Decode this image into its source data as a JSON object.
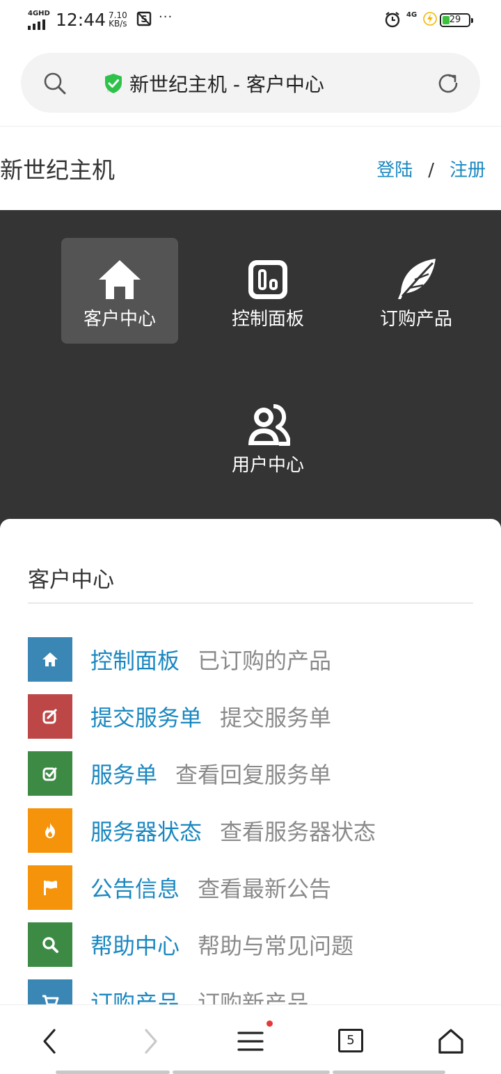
{
  "status": {
    "network": "4GHD",
    "time": "12:44",
    "speed_value": "7.10",
    "speed_unit": "KB/s",
    "network2": "4G",
    "battery": "29",
    "battery_level": 0.29,
    "dots": "···"
  },
  "address_bar": {
    "title": "新世纪主机 - 客户中心"
  },
  "header": {
    "brand": "新世纪主机",
    "login": "登陆",
    "separator": "/",
    "register": "注册"
  },
  "nav": {
    "items": [
      {
        "label": "客户中心",
        "icon": "home-icon",
        "active": true
      },
      {
        "label": "控制面板",
        "icon": "dashboard-icon",
        "active": false
      },
      {
        "label": "订购产品",
        "icon": "feather-icon",
        "active": false
      },
      {
        "label": "用户中心",
        "icon": "users-icon",
        "active": false
      }
    ]
  },
  "card": {
    "title": "客户中心",
    "rows": [
      {
        "label": "控制面板",
        "desc": "已订购的产品",
        "color": "#3a87b5",
        "icon": "home-icon"
      },
      {
        "label": "提交服务单",
        "desc": "提交服务单",
        "color": "#bd4747",
        "icon": "edit-icon"
      },
      {
        "label": "服务单",
        "desc": "查看回复服务单",
        "color": "#3d8a45",
        "icon": "check-icon"
      },
      {
        "label": "服务器状态",
        "desc": "查看服务器状态",
        "color": "#f5930a",
        "icon": "fire-icon"
      },
      {
        "label": "公告信息",
        "desc": "查看最新公告",
        "color": "#f5930a",
        "icon": "flag-icon"
      },
      {
        "label": "帮助中心",
        "desc": "帮助与常见问题",
        "color": "#3d8a45",
        "icon": "search-icon"
      },
      {
        "label": "订购产品",
        "desc": "订购新产品",
        "color": "#3a87b5",
        "icon": "cart-icon"
      }
    ]
  },
  "toolbar": {
    "tab_count": "5"
  }
}
